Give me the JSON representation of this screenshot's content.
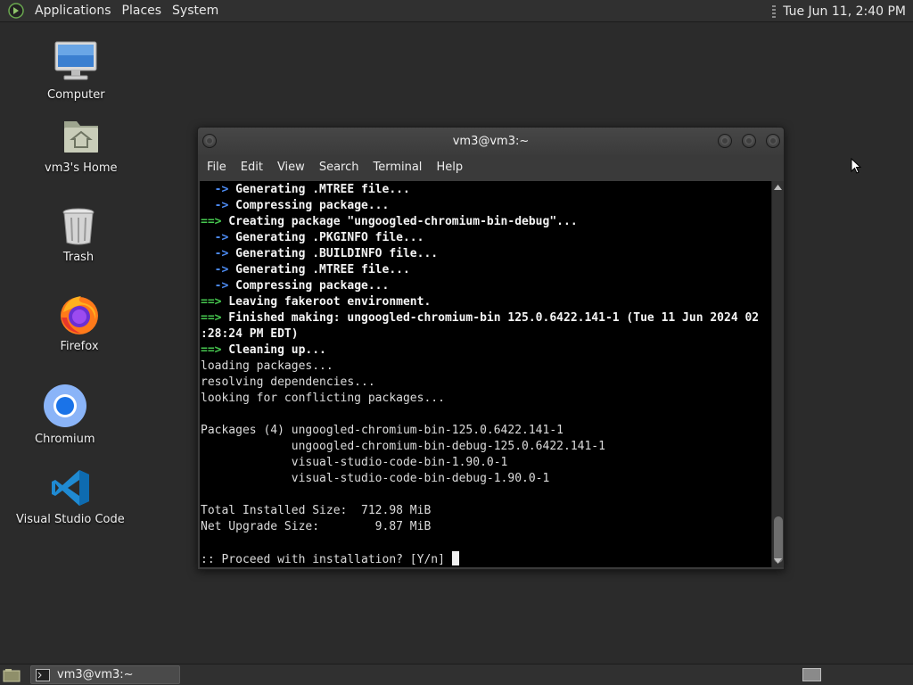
{
  "top_panel": {
    "menus": [
      "Applications",
      "Places",
      "System"
    ],
    "clock": "Tue Jun 11,  2:40 PM"
  },
  "desktop_icons": [
    {
      "label": "Computer",
      "icon": "computer-icon"
    },
    {
      "label": "vm3's Home",
      "icon": "home-folder-icon"
    },
    {
      "label": "Trash",
      "icon": "trash-icon"
    },
    {
      "label": "Firefox",
      "icon": "firefox-icon"
    },
    {
      "label": "Chromium",
      "icon": "chromium-icon"
    },
    {
      "label": "Visual Studio Code",
      "icon": "vscode-icon"
    }
  ],
  "window": {
    "title": "vm3@vm3:~",
    "menu": [
      "File",
      "Edit",
      "View",
      "Search",
      "Terminal",
      "Help"
    ]
  },
  "terminal": {
    "lines": [
      {
        "arrow": "  ->",
        "arrow_color": "blue",
        "text": " Generating .MTREE file...",
        "bold": true
      },
      {
        "arrow": "  ->",
        "arrow_color": "blue",
        "text": " Compressing package...",
        "bold": true
      },
      {
        "arrow": "==>",
        "arrow_color": "green",
        "text": " Creating package \"ungoogled-chromium-bin-debug\"...",
        "bold": true
      },
      {
        "arrow": "  ->",
        "arrow_color": "blue",
        "text": " Generating .PKGINFO file...",
        "bold": true
      },
      {
        "arrow": "  ->",
        "arrow_color": "blue",
        "text": " Generating .BUILDINFO file...",
        "bold": true
      },
      {
        "arrow": "  ->",
        "arrow_color": "blue",
        "text": " Generating .MTREE file...",
        "bold": true
      },
      {
        "arrow": "  ->",
        "arrow_color": "blue",
        "text": " Compressing package...",
        "bold": true
      },
      {
        "arrow": "==>",
        "arrow_color": "green",
        "text": " Leaving fakeroot environment.",
        "bold": true
      },
      {
        "arrow": "==>",
        "arrow_color": "green",
        "text": " Finished making: ungoogled-chromium-bin 125.0.6422.141-1 (Tue 11 Jun 2024 02",
        "bold": true
      },
      {
        "arrow": "",
        "arrow_color": "",
        "text": ":28:24 PM EDT)",
        "bold": true
      },
      {
        "arrow": "==>",
        "arrow_color": "green",
        "text": " Cleaning up...",
        "bold": true
      },
      {
        "arrow": "",
        "arrow_color": "",
        "text": "loading packages...",
        "bold": false
      },
      {
        "arrow": "",
        "arrow_color": "",
        "text": "resolving dependencies...",
        "bold": false
      },
      {
        "arrow": "",
        "arrow_color": "",
        "text": "looking for conflicting packages...",
        "bold": false
      },
      {
        "arrow": "",
        "arrow_color": "",
        "text": "",
        "bold": false
      },
      {
        "arrow": "",
        "arrow_color": "",
        "text": "Packages (4) ungoogled-chromium-bin-125.0.6422.141-1",
        "bold": false
      },
      {
        "arrow": "",
        "arrow_color": "",
        "text": "             ungoogled-chromium-bin-debug-125.0.6422.141-1",
        "bold": false
      },
      {
        "arrow": "",
        "arrow_color": "",
        "text": "             visual-studio-code-bin-1.90.0-1",
        "bold": false
      },
      {
        "arrow": "",
        "arrow_color": "",
        "text": "             visual-studio-code-bin-debug-1.90.0-1",
        "bold": false
      },
      {
        "arrow": "",
        "arrow_color": "",
        "text": "",
        "bold": false
      },
      {
        "arrow": "",
        "arrow_color": "",
        "text": "Total Installed Size:  712.98 MiB",
        "bold": false
      },
      {
        "arrow": "",
        "arrow_color": "",
        "text": "Net Upgrade Size:        9.87 MiB",
        "bold": false
      },
      {
        "arrow": "",
        "arrow_color": "",
        "text": "",
        "bold": false
      }
    ],
    "prompt": ":: Proceed with installation? [Y/n] "
  },
  "taskbar": {
    "window_button": "vm3@vm3:~"
  },
  "colors": {
    "arrow_blue": "#4d8cf5",
    "arrow_green": "#46c84f",
    "desktop_bg": "#2b2b2b"
  }
}
